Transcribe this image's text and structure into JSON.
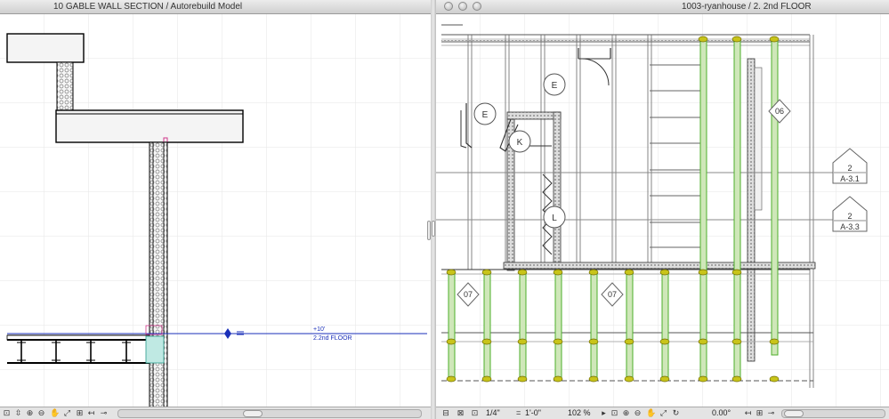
{
  "left_window": {
    "title": "10 GABLE WALL SECTION / Autorebuild Model",
    "level_marker": {
      "elevation": "+10'",
      "name": "2.2nd FLOOR"
    }
  },
  "right_window": {
    "title": "1003-ryanhouse / 2. 2nd FLOOR",
    "markers": {
      "room_e_upper": "E",
      "room_e_left": "E",
      "room_k": "K",
      "room_l": "L",
      "tag_06": "06",
      "tag_07_left": "07",
      "tag_07_mid": "07"
    },
    "section_markers": [
      {
        "number": "2",
        "sheet": "A-3.1"
      },
      {
        "number": "2",
        "sheet": "A-3.3"
      }
    ],
    "status": {
      "scale": "1/4\"",
      "equals": "=",
      "scale_value": "1'-0\"",
      "zoom": "102 %",
      "angle": "0.00°"
    }
  },
  "colors": {
    "joist_green": "#4caf2a",
    "joist_fill": "#cfe7b9",
    "node_yellow": "#c8c41a",
    "line_blue": "#1a2fb8",
    "grid": "#e6e6e6"
  }
}
